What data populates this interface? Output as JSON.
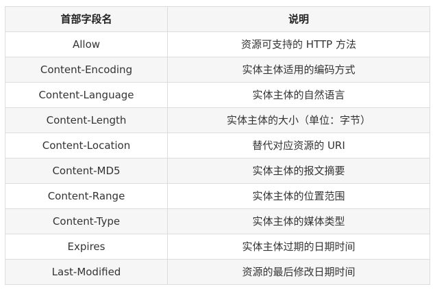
{
  "table": {
    "columns": [
      "首部字段名",
      "说明"
    ],
    "rows": [
      [
        "Allow",
        "资源可支持的 HTTP 方法"
      ],
      [
        "Content-Encoding",
        "实体主体适用的编码方式"
      ],
      [
        "Content-Language",
        "实体主体的自然语言"
      ],
      [
        "Content-Length",
        "实体主体的大小（单位：字节）"
      ],
      [
        "Content-Location",
        "替代对应资源的 URI"
      ],
      [
        "Content-MD5",
        "实体主体的报文摘要"
      ],
      [
        "Content-Range",
        "实体主体的位置范围"
      ],
      [
        "Content-Type",
        "实体主体的媒体类型"
      ],
      [
        "Expires",
        "实体主体过期的日期时间"
      ],
      [
        "Last-Modified",
        "资源的最后修改日期时间"
      ]
    ]
  }
}
